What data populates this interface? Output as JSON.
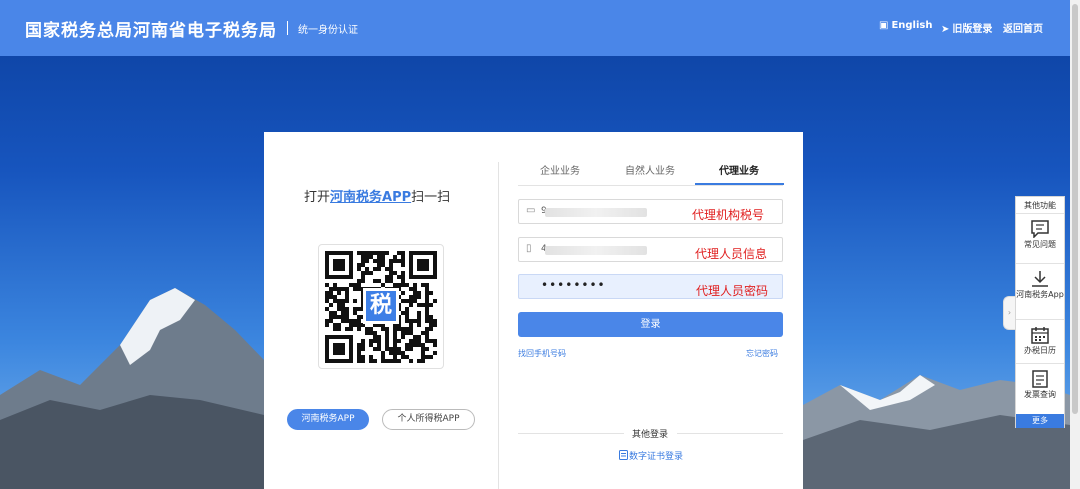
{
  "header": {
    "title": "国家税务总局河南省电子税务局",
    "subtitle": "统一身份认证",
    "links": [
      {
        "icon": "flag-icon",
        "glyph": "▣",
        "label": "English"
      },
      {
        "icon": "send-icon",
        "glyph": "➤",
        "label": "旧版登录"
      },
      {
        "icon": "",
        "glyph": "",
        "label": "返回首页"
      }
    ]
  },
  "qr_panel": {
    "scan_prefix": "打开",
    "scan_app": "河南税务APP",
    "scan_suffix": "扫一扫",
    "qr_logo_text": "税",
    "app_buttons": [
      "河南税务APP",
      "个人所得税APP"
    ]
  },
  "login": {
    "tabs": [
      "企业业务",
      "自然人业务",
      "代理业务"
    ],
    "active_tab": 2,
    "fields": [
      {
        "icon": "id-card-icon",
        "prefix": "9",
        "value_hidden": true,
        "annotation": "代理机构税号"
      },
      {
        "icon": "phone-icon",
        "prefix": "4",
        "value_hidden": true,
        "annotation": "代理人员信息"
      },
      {
        "icon": "",
        "prefix": "••••••••",
        "value_hidden": false,
        "annotation": "代理人员密码"
      }
    ],
    "submit_label": "登录",
    "find_phone_link": "找回手机号码",
    "forgot_password_link": "忘记密码",
    "other_login_title": "其他登录",
    "cert_login_link": "数字证书登录"
  },
  "side_panel": {
    "title": "其他功能",
    "items": [
      {
        "icon": "chat-icon",
        "label": "常见问题"
      },
      {
        "icon": "download-icon",
        "label": "河南税务App"
      },
      {
        "icon": "calendar-icon",
        "label": "办税日历"
      },
      {
        "icon": "document-icon",
        "label": "发票查询"
      }
    ],
    "more_label": "更多"
  },
  "colors": {
    "header": "#4a86e8",
    "accent": "#3a7be0",
    "annotation": "#e02020"
  }
}
